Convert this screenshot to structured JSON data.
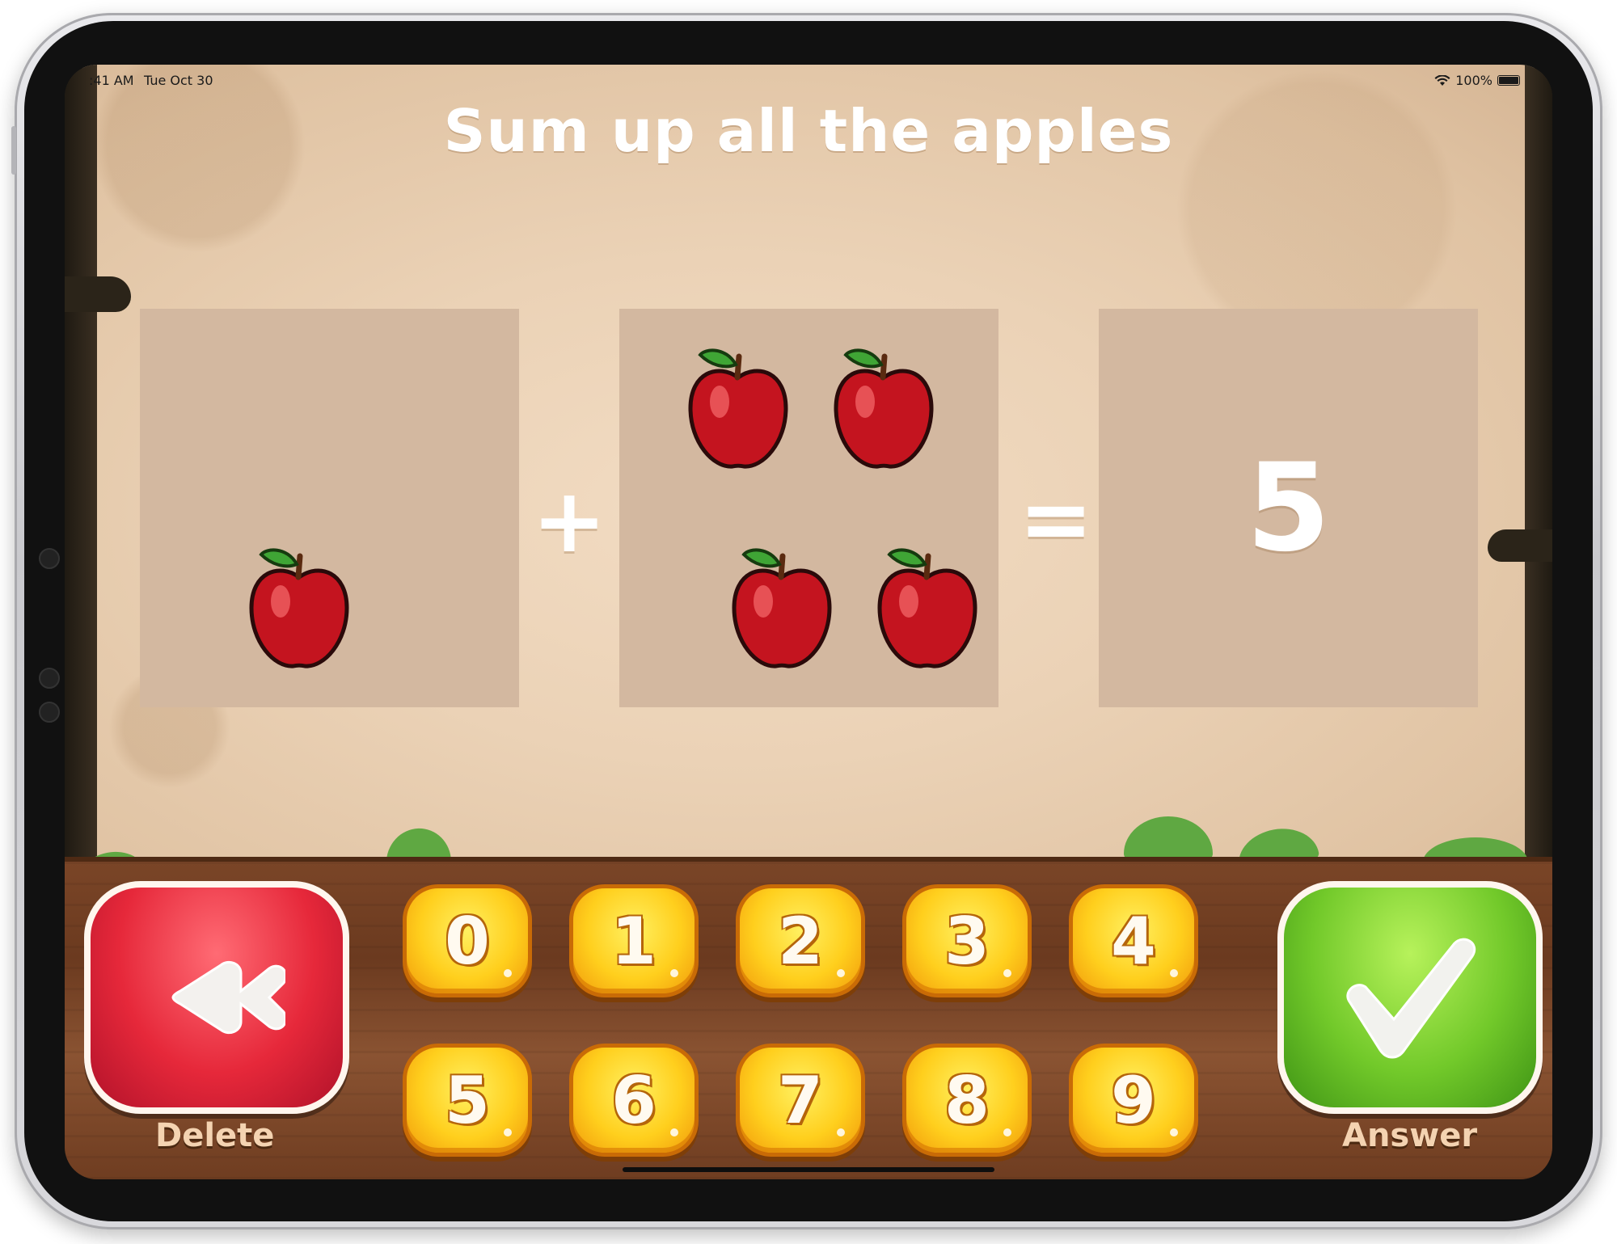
{
  "status_bar": {
    "time": ":41 AM",
    "date": "Tue Oct 30",
    "battery": "100%"
  },
  "game": {
    "title": "Sum up all the apples",
    "operator_plus": "+",
    "operator_equals": "=",
    "left_panel_apple_count": 1,
    "middle_panel_apple_count": 4,
    "answer": "5"
  },
  "keypad": {
    "digits": [
      "0",
      "1",
      "2",
      "3",
      "4",
      "5",
      "6",
      "7",
      "8",
      "9"
    ]
  },
  "controls": {
    "delete_label": "Delete",
    "answer_label": "Answer"
  },
  "colors": {
    "delete_button": "#e6283a",
    "answer_button": "#72c92a",
    "digit_button": "#ffcf1d",
    "panel": "#d3b8a0",
    "wood": "#6b3a1f"
  }
}
